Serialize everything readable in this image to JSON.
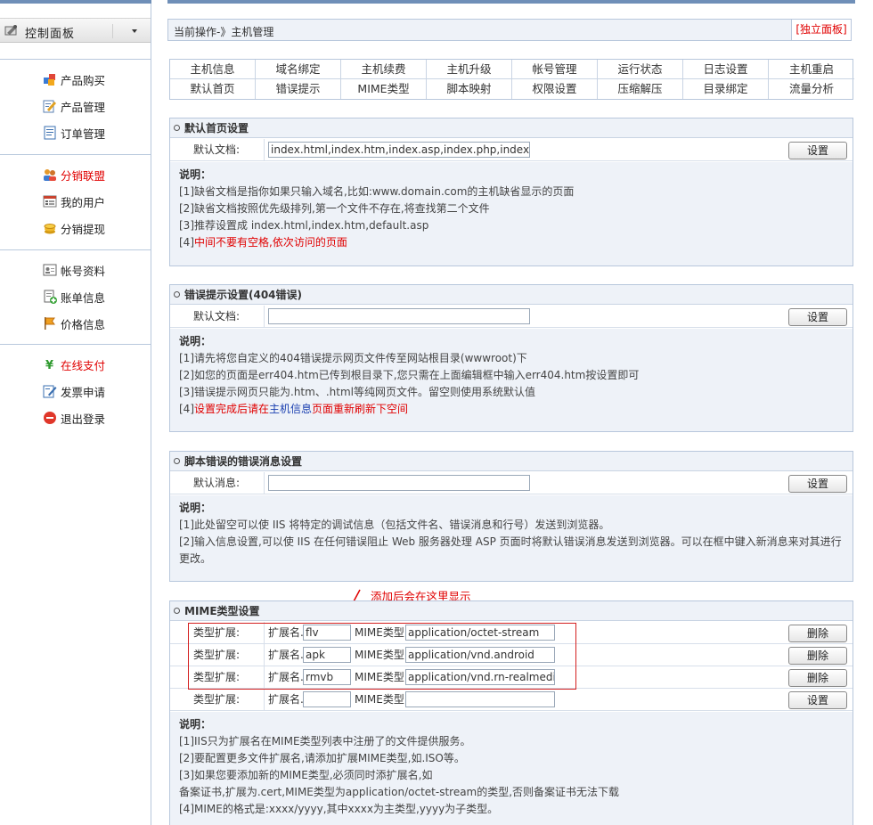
{
  "sidebar": {
    "title": "控制面板",
    "groups": [
      {
        "items": [
          {
            "label": "产品购买",
            "icon": "cubes-icon",
            "red": false
          },
          {
            "label": "产品管理",
            "icon": "edit-icon",
            "red": false
          },
          {
            "label": "订单管理",
            "icon": "document-icon",
            "red": false
          }
        ]
      },
      {
        "items": [
          {
            "label": "分销联盟",
            "icon": "users-icon",
            "red": true
          },
          {
            "label": "我的用户",
            "icon": "user-list-icon",
            "red": false
          },
          {
            "label": "分销提现",
            "icon": "coins-icon",
            "red": false
          }
        ]
      },
      {
        "items": [
          {
            "label": "帐号资料",
            "icon": "id-card-icon",
            "red": false
          },
          {
            "label": "账单信息",
            "icon": "bill-add-icon",
            "red": false
          },
          {
            "label": "价格信息",
            "icon": "flag-icon",
            "red": false
          }
        ]
      },
      {
        "items": [
          {
            "label": "在线支付",
            "icon": "yen-icon",
            "red": true
          },
          {
            "label": "发票申请",
            "icon": "invoice-pen-icon",
            "red": false
          },
          {
            "label": "退出登录",
            "icon": "logout-icon",
            "red": false
          }
        ]
      }
    ]
  },
  "breadcrumb": {
    "text": "当前操作-》主机管理",
    "independent_panel": "[独立面板]"
  },
  "nav": {
    "row1": [
      "主机信息",
      "域名绑定",
      "主机续费",
      "主机升级",
      "帐号管理",
      "运行状态",
      "日志设置",
      "主机重启"
    ],
    "row2": [
      "默认首页",
      "错误提示",
      "MIME类型",
      "脚本映射",
      "权限设置",
      "压缩解压",
      "目录绑定",
      "流量分析"
    ]
  },
  "default_page": {
    "title": "默认首页设置",
    "label": "默认文档:",
    "value": "index.html,index.htm,index.asp,index.php,index.asp",
    "button": "设置",
    "notes": {
      "heading": "说明：",
      "line1": "[1]缺省文档是指你如果只输入域名,比如:www.domain.com的主机缺省显示的页面",
      "line2": "[2]缺省文档按照优先级排列,第一个文件不存在,将查找第二个文件",
      "line3": "[3]推荐设置成 index.html,index.htm,default.asp",
      "line4_prefix": "[4]",
      "line4_red": "中间不要有空格,依次访问的页面"
    }
  },
  "error_page": {
    "title": "错误提示设置(404错误)",
    "label": "默认文档:",
    "value": "",
    "button": "设置",
    "notes": {
      "heading": "说明：",
      "line1": "[1]请先将您自定义的404错误提示网页文件传至网站根目录(wwwroot)下",
      "line2": "[2]如您的页面是err404.htm已传到根目录下,您只需在上面编辑框中输入err404.htm按设置即可",
      "line3": "[3]错误提示网页只能为.htm、.html等纯网页文件。留空则使用系统默认值",
      "line4_prefix": "[4]",
      "line4_red1": "设置完成后请在",
      "line4_blue": "主机信息",
      "line4_red2": "页面重新刷新下空间"
    }
  },
  "script_error": {
    "title": "脚本错误的错误消息设置",
    "label": "默认消息:",
    "value": "",
    "button": "设置",
    "notes": {
      "heading": "说明：",
      "line1": "[1]此处留空可以使 IIS 将特定的调试信息（包括文件名、错误消息和行号）发送到浏览器。",
      "line2": "[2]输入信息设置,可以使 IIS 在任何错误阻止 Web 服务器处理 ASP 页面时将默认错误消息发送到浏览器。可以在框中键入新消息来对其进行",
      "line3": "更改。"
    }
  },
  "annotation": "添加后会在这里显示",
  "mime": {
    "title": "MIME类型设置",
    "row_label": "类型扩展:",
    "ext_label": "扩展名.",
    "mime_label": "MIME类型",
    "rows": [
      {
        "ext": "flv",
        "mime": "application/octet-stream",
        "button": "删除"
      },
      {
        "ext": "apk",
        "mime": "application/vnd.android",
        "button": "删除"
      },
      {
        "ext": "rmvb",
        "mime": "application/vnd.rn-realmedia",
        "button": "删除"
      },
      {
        "ext": "",
        "mime": "",
        "button": "设置"
      }
    ],
    "notes": {
      "heading": "说明：",
      "line1": "[1]IIS只为扩展名在MIME类型列表中注册了的文件提供服务。",
      "line2": "[2]要配置更多文件扩展名,请添加扩展MIME类型,如.ISO等。",
      "line3": "[3]如果您要添加新的MIME类型,必须同时添扩展名,如",
      "line4": "备案证书,扩展为.cert,MIME类型为application/octet-stream的类型,否则备案证书无法下载",
      "line5": "[4]MIME的格式是:xxxx/yyyy,其中xxxx为主类型,yyyy为子类型。"
    }
  },
  "colors": {
    "accent_red": "#e00000",
    "border": "#b8c7dc",
    "header_bg": "#eef2f8",
    "link_blue": "#1a3fb0"
  }
}
